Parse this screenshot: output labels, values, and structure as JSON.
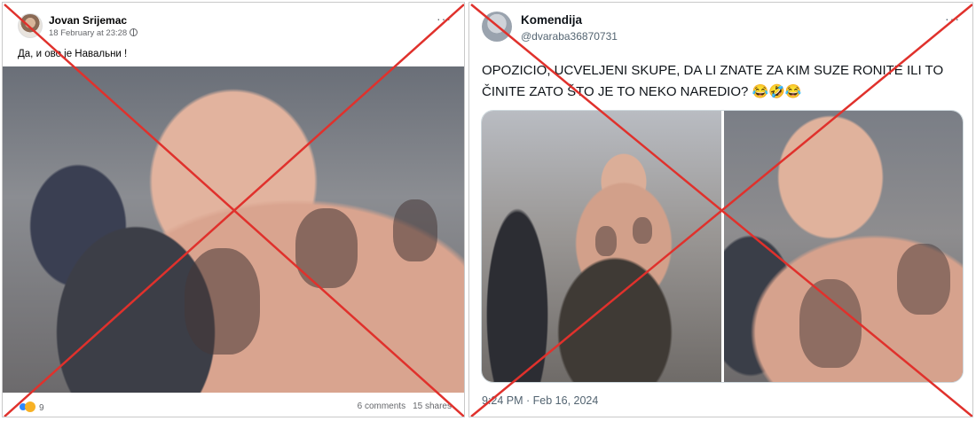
{
  "facebook_post": {
    "author": "Jovan Srijemac",
    "timestamp": "18 February at 23:28",
    "text": "Да, и ово је Навальни !",
    "reaction_count": "9",
    "comments": "6 comments",
    "shares": "15 shares",
    "more_icon": "more-dots-icon",
    "privacy_icon": "globe-icon"
  },
  "twitter_post": {
    "display_name": "Komendija",
    "handle": "@dvaraba36870731",
    "text": "OPOZICIO, UCVELJENI SKUPE, DA LI ZNATE ZA KIM SUZE RONITE ILI TO ČINITE ZATO ŠTO JE TO NEKO NAREDIO? 😂🤣😂",
    "date": "9:24 PM · Feb 16, 2024",
    "more_icon": "more-dots-icon"
  },
  "colors": {
    "false_cross": "#e0312c",
    "meta_text": "#65676b",
    "twitter_meta": "#536471"
  }
}
